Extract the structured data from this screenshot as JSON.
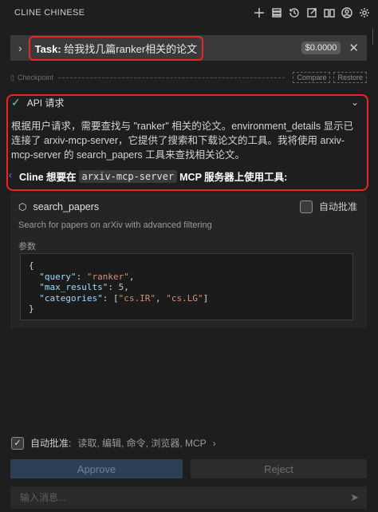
{
  "header": {
    "title": "CLINE CHINESE",
    "icons": [
      "plus-icon",
      "servers-icon",
      "history-icon",
      "external-link-icon",
      "book-icon",
      "account-icon",
      "settings-icon"
    ]
  },
  "task": {
    "label": "Task:",
    "text": "给我找几篇ranker相关的论文",
    "cost": "$0.0000",
    "close": "✕"
  },
  "checkpoint": {
    "label": "Checkpoint",
    "compare": "Compare",
    "restore": "Restore"
  },
  "api": {
    "title": "API 请求",
    "paragraph": "根据用户请求，需要查找与 \"ranker\" 相关的论文。environment_details 显示已连接了 arxiv-mcp-server，它提供了搜索和下载论文的工具。我将使用 arxiv-mcp-server 的 search_papers 工具来查找相关论文。",
    "cline_prefix": "Cline 想要在",
    "server": "arxiv-mcp-server",
    "cline_suffix": "MCP 服务器上使用工具:"
  },
  "tool": {
    "name": "search_papers",
    "auto_approve": "自动批准",
    "description": "Search for papers on arXiv with advanced filtering",
    "params_label": "参数",
    "params": {
      "query_key": "\"query\"",
      "query_val": "\"ranker\"",
      "max_key": "\"max_results\"",
      "max_val": "5",
      "cat_key": "\"categories\"",
      "cat_val1": "\"cs.IR\"",
      "cat_val2": "\"cs.LG\""
    }
  },
  "footer": {
    "auto_approve_label": "自动批准:",
    "auto_approve_list": "读取, 编辑, 命令, 浏览器, MCP",
    "approve": "Approve",
    "reject": "Reject",
    "input_placeholder": "输入消息..."
  },
  "colors": {
    "highlight": "#e8262a",
    "background": "#1e1e1e",
    "success": "#73c991"
  }
}
